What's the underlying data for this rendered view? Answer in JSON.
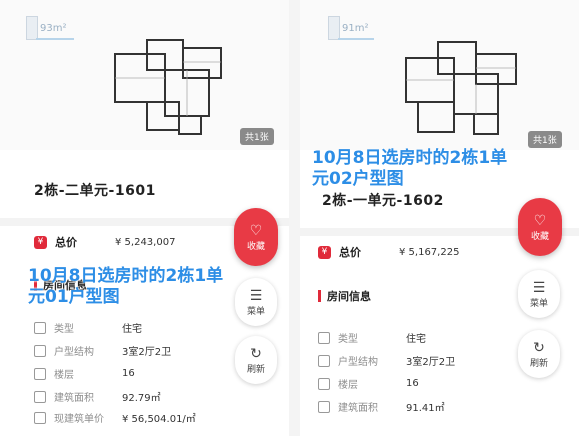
{
  "left": {
    "area_badge": "93m²",
    "image_count": "共1张",
    "unit_title": "2栋-二单元-1601",
    "price": {
      "label": "总价",
      "value": "¥ 5,243,007"
    },
    "section_title": "房间信息",
    "fab": {
      "favorite": "收藏",
      "menu": "菜单",
      "refresh": "刷新"
    },
    "overlay": {
      "line1": "10月8日选房时的2栋1单",
      "line2": "元01户型图"
    },
    "info_rows": [
      {
        "label": "类型",
        "value": "住宅"
      },
      {
        "label": "户型结构",
        "value": "3室2厅2卫"
      },
      {
        "label": "楼层",
        "value": "16"
      },
      {
        "label": "建筑面积",
        "value": "92.79㎡"
      },
      {
        "label": "现建筑单价",
        "value": "¥ 56,504.01/㎡"
      }
    ]
  },
  "right": {
    "area_badge": "91m²",
    "image_count": "共1张",
    "unit_title": "2栋-一单元-1602",
    "price": {
      "label": "总价",
      "value": "¥ 5,167,225"
    },
    "section_title": "房间信息",
    "fab": {
      "favorite": "收藏",
      "menu": "菜单",
      "refresh": "刷新"
    },
    "overlay": {
      "line1": "10月8日选房时的2栋1单",
      "line2": "元02户型图"
    },
    "info_rows": [
      {
        "label": "类型",
        "value": "住宅"
      },
      {
        "label": "户型结构",
        "value": "3室2厅2卫"
      },
      {
        "label": "楼层",
        "value": "16"
      },
      {
        "label": "建筑面积",
        "value": "91.41㎡"
      }
    ]
  },
  "icons": {
    "favorite": "heart-icon",
    "menu": "list-icon",
    "refresh": "refresh-icon",
    "price": "price-tag-icon"
  },
  "colors": {
    "accent_red": "#e83a45",
    "overlay_blue": "#2d8ee6"
  }
}
